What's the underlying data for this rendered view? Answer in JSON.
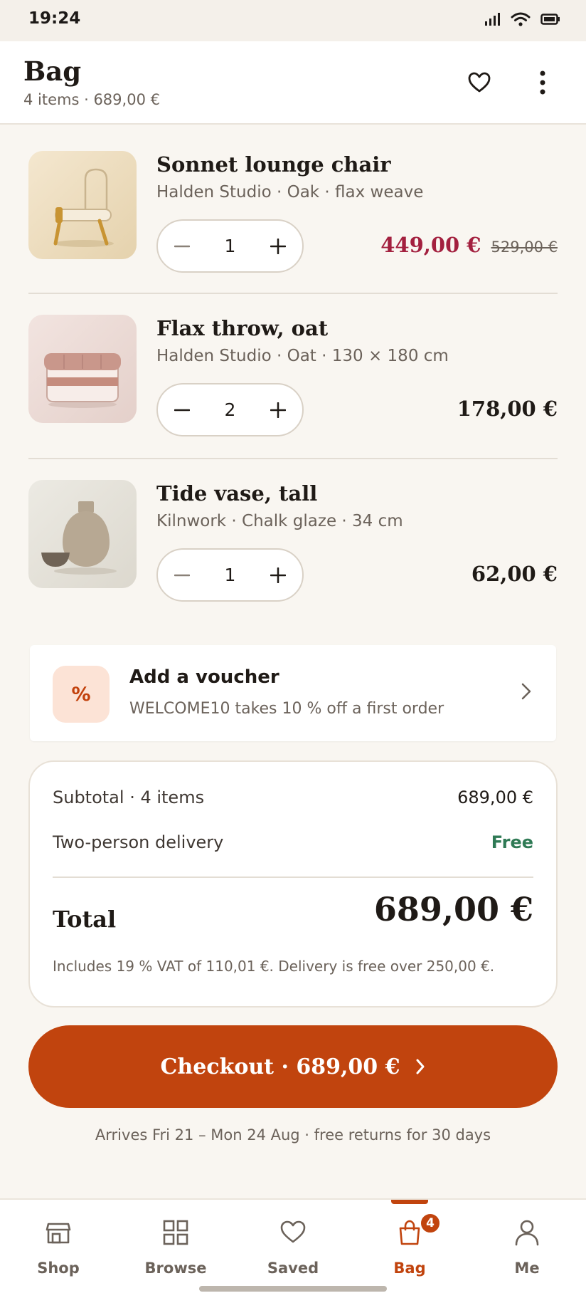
{
  "status_bar": {
    "time": "19:24",
    "icons": [
      "signal-icon",
      "wifi-icon",
      "battery-icon"
    ]
  },
  "header": {
    "title": "Bag",
    "subtitle": "4 items · 689,00 €",
    "actions": [
      "heart-icon",
      "more-vertical-icon"
    ]
  },
  "items": [
    {
      "name": "Sonnet lounge chair",
      "meta": "Halden Studio · Oak · flax weave",
      "qty": "1",
      "price": "449,00 €",
      "price_was": "529,00 €",
      "on_sale": true,
      "thumb_icon": "lounge-chair-image"
    },
    {
      "name": "Flax throw, oat",
      "meta": "Halden Studio · Oat · 130 × 180 cm",
      "qty": "2",
      "price": "178,00 €",
      "thumb_icon": "folded-throw-image"
    },
    {
      "name": "Tide vase, tall",
      "meta": "Kilnwork · Chalk glaze · 34 cm",
      "qty": "1",
      "price": "62,00 €",
      "thumb_icon": "vase-image"
    }
  ],
  "voucher": {
    "icon": "%",
    "title": "Add a voucher",
    "description": "WELCOME10 takes 10 % off a first order"
  },
  "summary": {
    "subtotal_label": "Subtotal · 4 items",
    "subtotal_value": "689,00 €",
    "delivery_label": "Two-person delivery",
    "delivery_value": "Free",
    "total_label": "Total",
    "total_value": "689,00 €",
    "note": "Includes 19 % VAT of 110,01 €. Delivery is free over 250,00 €."
  },
  "checkout": {
    "label": "Checkout · 689,00 €"
  },
  "arrival_note": "Arrives Fri 21 – Mon 24 Aug · free returns for 30 days",
  "nav": {
    "active": "Bag",
    "badge": "4",
    "items": [
      {
        "label": "Shop",
        "icon": "storefront-icon"
      },
      {
        "label": "Browse",
        "icon": "grid-icon"
      },
      {
        "label": "Saved",
        "icon": "heart-icon"
      },
      {
        "label": "Bag",
        "icon": "shopping-bag-icon"
      },
      {
        "label": "Me",
        "icon": "person-icon"
      }
    ]
  },
  "colors": {
    "accent": "#c1440e",
    "sale": "#a3203f",
    "free": "#2f7a55",
    "background": "#f9f6f1"
  }
}
